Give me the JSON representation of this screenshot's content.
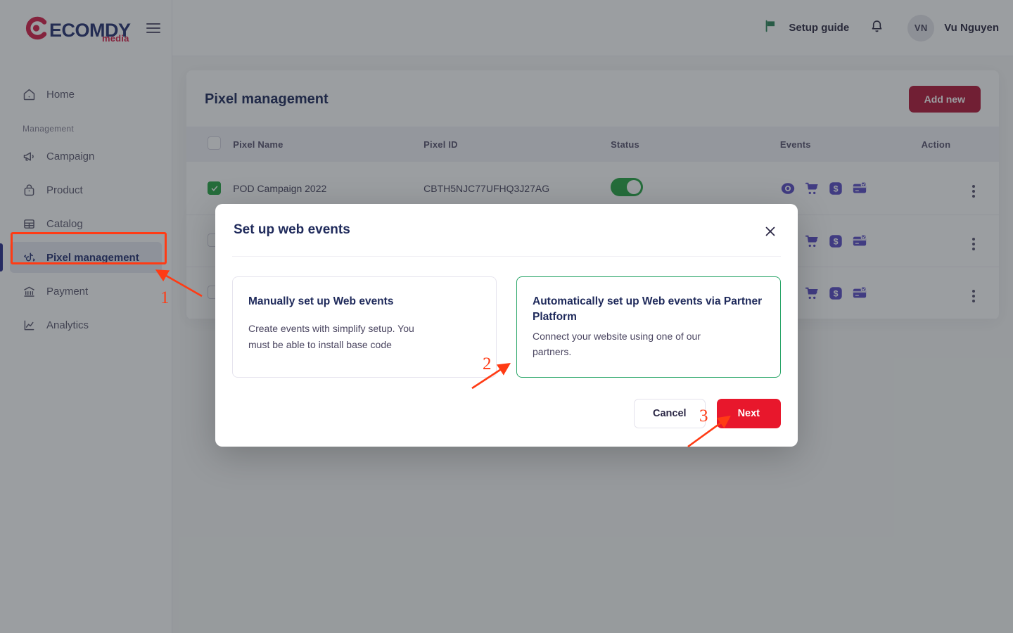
{
  "brand": {
    "name": "ECOMDY",
    "sub": "media",
    "logo_color": "#d6204a",
    "text_color": "#273272"
  },
  "topbar": {
    "setup_guide_label": "Setup guide",
    "flag_icon": "green-flag-icon",
    "bell_icon": "bell-icon",
    "avatar_initials": "VN",
    "user_name": "Vu Nguyen"
  },
  "sidebar": {
    "section_label": "Management",
    "items": [
      {
        "label": "Home",
        "icon": "home-icon",
        "active": false
      },
      {
        "label": "Campaign",
        "icon": "megaphone-icon",
        "active": false
      },
      {
        "label": "Product",
        "icon": "bag-icon",
        "active": false
      },
      {
        "label": "Catalog",
        "icon": "catalog-icon",
        "active": false
      },
      {
        "label": "Pixel management",
        "icon": "pixel-icon",
        "active": true
      },
      {
        "label": "Payment",
        "icon": "bank-icon",
        "active": false
      },
      {
        "label": "Analytics",
        "icon": "chart-line-icon",
        "active": false
      }
    ]
  },
  "main": {
    "page_title": "Pixel management",
    "add_button_label": "Add new",
    "add_button_color": "#b3193a",
    "table": {
      "headers": [
        "",
        "Pixel Name",
        "Pixel ID",
        "Status",
        "Events",
        "Action"
      ],
      "rows": [
        {
          "checked": true,
          "pixel_name": "POD Campaign 2022",
          "pixel_id": "CBTH5NJC77UFHQ3J27AG",
          "status_on": true,
          "events": [
            "view-content-icon",
            "add-to-cart-icon",
            "dollar-icon",
            "payment-card-icon"
          ]
        },
        {
          "checked": false,
          "pixel_name": "",
          "pixel_id": "",
          "status_on": false,
          "events": [
            "view-content-icon",
            "add-to-cart-icon",
            "dollar-icon",
            "payment-card-icon"
          ]
        },
        {
          "checked": false,
          "pixel_name": "",
          "pixel_id": "",
          "status_on": false,
          "events": [
            "view-content-icon",
            "add-to-cart-icon",
            "dollar-icon",
            "payment-card-icon"
          ]
        }
      ]
    }
  },
  "modal": {
    "title": "Set up web events",
    "close_icon": "close-icon",
    "options": [
      {
        "title": "Manually set up Web events",
        "desc": "Create events with simplify setup. You must be able to install base code",
        "selected": false
      },
      {
        "title": "Automatically set up Web events via Partner Platform",
        "desc": "Connect your website using one of our partners.",
        "selected": true
      }
    ],
    "cancel_label": "Cancel",
    "next_label": "Next",
    "next_color": "#e8172c",
    "selected_border_color": "#28a567"
  },
  "annotations": {
    "color": "#ff3b14",
    "markers": [
      {
        "number": "1",
        "target": "sidebar-item-pixel-management"
      },
      {
        "number": "2",
        "target": "option-automatic-card"
      },
      {
        "number": "3",
        "target": "next-button"
      }
    ]
  }
}
